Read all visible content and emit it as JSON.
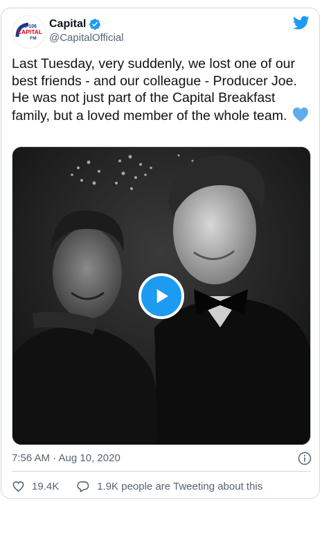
{
  "author": {
    "display_name": "Capital",
    "handle": "@CapitalOfficial",
    "avatar_lines": [
      "95-106",
      "CAPITAL",
      "FM"
    ]
  },
  "icons": {
    "verified": "verified-badge-icon",
    "brand": "twitter-bird-icon",
    "emoji": "blue-heart-icon",
    "media": "play-icon",
    "info": "info-icon",
    "like": "heart-outline-icon",
    "reply": "speech-bubble-icon"
  },
  "tweet": {
    "text": "Last Tuesday, very suddenly, we lost one of our best friends - and our colleague - Producer Joe. He was not just part of the Capital Breakfast family, but a loved member of the whole team.",
    "timestamp": "7:56 AM · Aug 10, 2020"
  },
  "actions": {
    "likes": "19.4K",
    "replies_text": "1.9K people are Tweeting about this"
  },
  "colors": {
    "accent": "#1d9bf0",
    "text": "#0f1419",
    "muted": "#536471",
    "border": "#cfd9de",
    "emoji_heart": "#5dadec"
  }
}
